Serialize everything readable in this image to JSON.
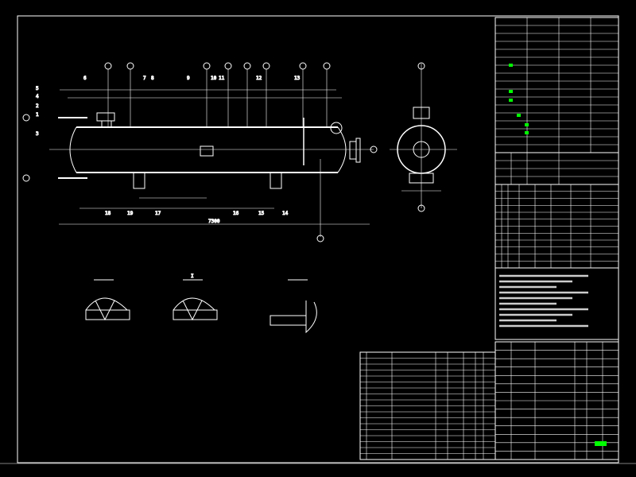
{
  "colors": {
    "background": "#000000",
    "lines": "#ffffff",
    "highlight": "#00ff00"
  },
  "main_view": {
    "part_numbers": [
      "1",
      "2",
      "3",
      "4",
      "5",
      "6",
      "7",
      "8",
      "9",
      "10",
      "11",
      "12",
      "13",
      "14",
      "15",
      "16",
      "17",
      "18",
      "19"
    ],
    "overall_length": "7300"
  },
  "details": [
    {
      "label": ""
    },
    {
      "label": "I"
    },
    {
      "label": ""
    }
  ],
  "side_view": {
    "label": ""
  }
}
